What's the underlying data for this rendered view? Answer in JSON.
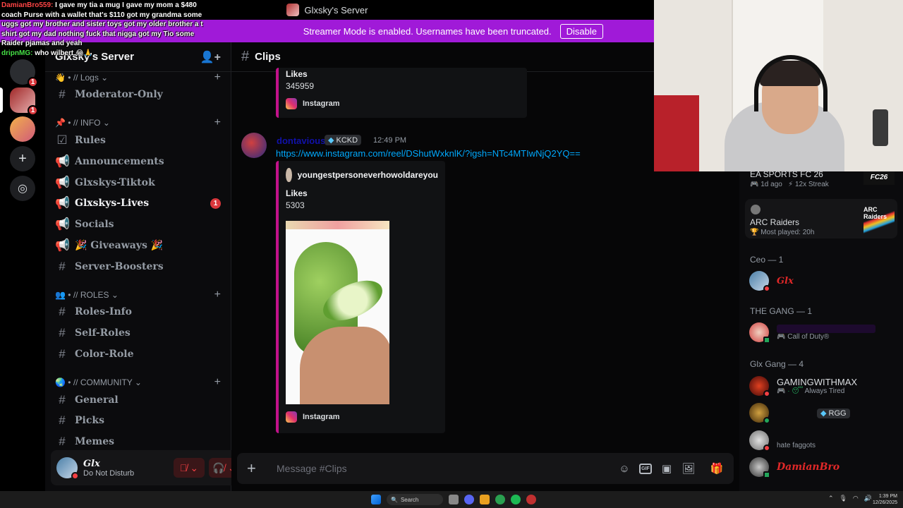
{
  "window": {
    "title": "Glxsky's Server"
  },
  "banner": {
    "text": "Streamer Mode is enabled. Usernames have been truncated.",
    "button": "Disable"
  },
  "server": {
    "name": "Glxsky's Server"
  },
  "rail": {
    "badge1": "1",
    "badge2": "1",
    "add_icon": "plus-icon",
    "discover_icon": "compass-icon"
  },
  "categories": {
    "logs": "• // Logs",
    "info": "• // INFO",
    "roles": "• // ROLES",
    "community": "• // COMMUNITY"
  },
  "channels": {
    "moderator_only": "Moderator-Only",
    "rules": "Rules",
    "announcements": "Announcements",
    "tiktok": "Glxskys-Tiktok",
    "lives": "Glxskys-Lives",
    "lives_badge": "1",
    "socials": "Socials",
    "giveaways": "🎉 Giveaways 🎉",
    "boosters": "Server-Boosters",
    "roles_info": "Roles-Info",
    "self_roles": "Self-Roles",
    "color_role": "Color-Role",
    "general": "General",
    "picks": "Picks",
    "memes": "Memes"
  },
  "user": {
    "name": "Glx",
    "status": "Do Not Disturb"
  },
  "chat": {
    "channel": "Clips",
    "embed1": {
      "label": "Likes",
      "value": "345959",
      "provider": "Instagram"
    },
    "message": {
      "author": "dontavious",
      "tag": "KCKD",
      "time": "12:49 PM",
      "link": "https://www.instagram.com/reel/DShutWxknlK/?igsh=NTc4MTIwNjQ2YQ=="
    },
    "embed2": {
      "author": "youngestpersoneverhowoldareyou",
      "label": "Likes",
      "value": "5303",
      "provider": "Instagram"
    },
    "composer_placeholder": "Message #Clips"
  },
  "members_panel": {
    "activities": [
      {
        "title": "EA SPORTS FC 26",
        "sub1": "1d ago",
        "sub2": "12x Streak",
        "logo": "FC26"
      },
      {
        "title": "ARC Raiders",
        "sub1": "Most played: 20h",
        "logo": "ARC Raiders"
      }
    ],
    "groups": [
      {
        "label": "Ceo — 1"
      },
      {
        "label": "THE GANG — 1"
      },
      {
        "label": "Glx Gang — 4"
      }
    ],
    "members": {
      "glx": "Glx",
      "gang_sub": "Call of Duty®",
      "max_name": "GAMINGWITHMAX",
      "max_sub": "Always Tired",
      "rgg_tag": "RGG",
      "m3_sub": "hate faggots",
      "damian": "DamianBro"
    }
  },
  "stream_chat": [
    {
      "user": "DamianBro559:",
      "text": " I gave my tia a mug I gave my mom a $480 coach Purse with a wallet that's $110 got my grandma some uggs got my brother and sister toys got my older brother a t shirt got my dad nothing fuck that nigga got my Tio some Raider pjamas and yeah"
    },
    {
      "user": "dripnMG:",
      "text": " who wilbert 😂🙏"
    }
  ],
  "taskbar": {
    "search": "Search",
    "time": "1:39 PM",
    "date": "12/26/2025"
  },
  "colors": {
    "accent": "#a01ad8",
    "embed_border": "#c1128a",
    "link": "#00a8fc",
    "dnd": "#f23f43",
    "badge": "#da373c"
  }
}
